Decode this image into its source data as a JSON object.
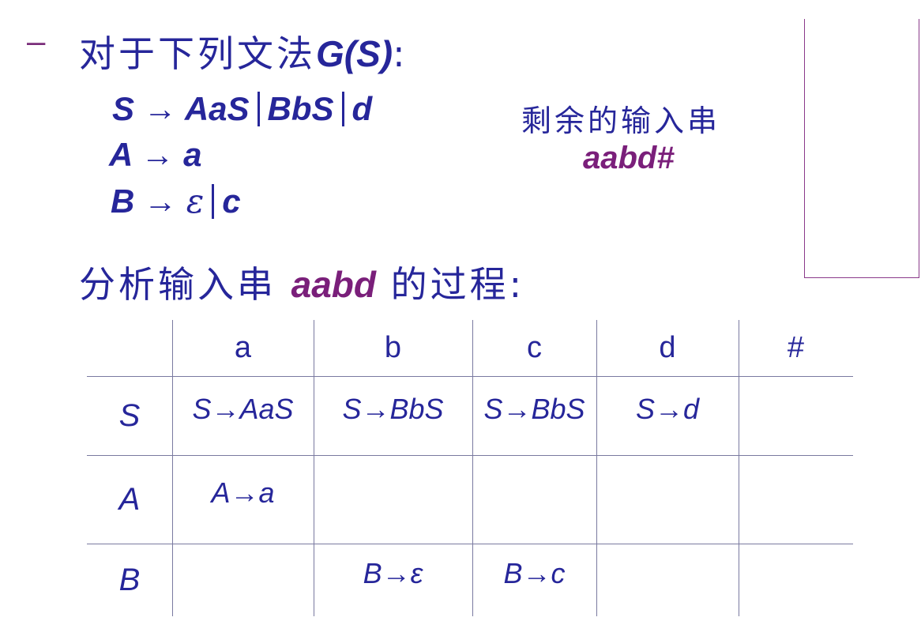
{
  "heading": {
    "dash": "–",
    "text": "对于下列文法",
    "grammar_name": "G(S)",
    "colon": ":"
  },
  "grammar": {
    "rules": [
      {
        "lhs": "S",
        "arrow": "→",
        "alternatives": [
          "AaS",
          "BbS",
          "d"
        ]
      },
      {
        "lhs": "A",
        "arrow": "→",
        "alternatives": [
          "a"
        ]
      },
      {
        "lhs": "B",
        "arrow": "→",
        "alternatives": [
          "ε",
          "c"
        ]
      }
    ]
  },
  "remaining_input": {
    "label": "剩余的输入串",
    "value": "aabd#"
  },
  "analysis": {
    "prefix": "分析输入串",
    "string": "aabd",
    "suffix": "的过程:"
  },
  "parse_table": {
    "columns": [
      "a",
      "b",
      "c",
      "d",
      "#"
    ],
    "rows": [
      {
        "nonterminal": "S",
        "cells": [
          "S→AaS",
          "S→BbS",
          "S→BbS",
          "S→d",
          ""
        ]
      },
      {
        "nonterminal": "A",
        "cells": [
          "A→a",
          "",
          "",
          "",
          ""
        ]
      },
      {
        "nonterminal": "B",
        "cells": [
          "",
          "B→ε",
          "B→c",
          "",
          ""
        ]
      }
    ]
  },
  "colors": {
    "text": "#26269a",
    "highlight": "#7a1f7a",
    "table_lines": "#7a7aa0"
  }
}
